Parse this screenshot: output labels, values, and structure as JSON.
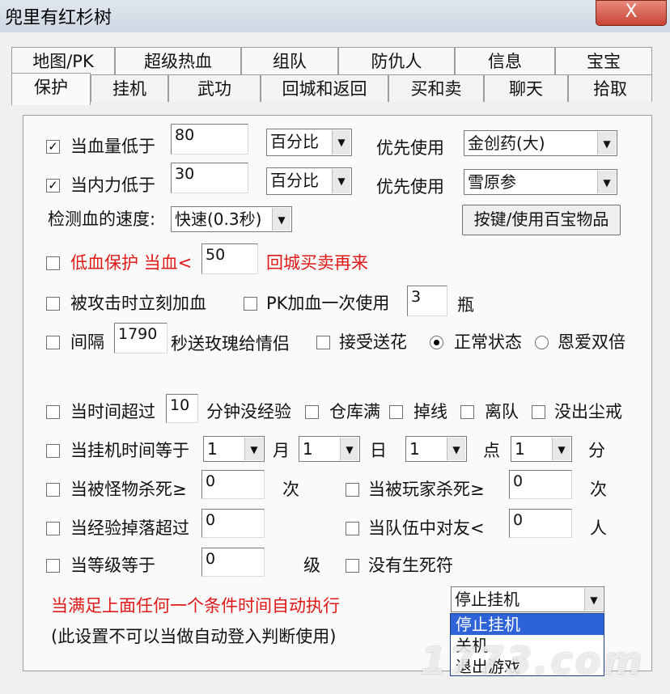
{
  "window": {
    "title": "兜里有红杉树",
    "close_label": "X"
  },
  "tabs_row1": [
    "地图/PK",
    "超级热血",
    "组队",
    "防仇人",
    "信息",
    "宝宝"
  ],
  "tabs_row2": [
    "保护",
    "挂机",
    "武功",
    "回城和返回",
    "买和卖",
    "聊天",
    "拾取"
  ],
  "protect": {
    "hp_label": "当血量低于",
    "hp_value": "80",
    "hp_unit": "百分比",
    "hp_use_label": "优先使用",
    "hp_item": "金创药(大)",
    "mp_label": "当内力低于",
    "mp_value": "30",
    "mp_unit": "百分比",
    "mp_use_label": "优先使用",
    "mp_item": "雪原参",
    "speed_label": "检测血的速度:",
    "speed_value": "快速(0.3秒)",
    "hotkey_button": "按键/使用百宝物品",
    "low_hp_label": "低血保护 当血<",
    "low_hp_value": "50",
    "low_hp_suffix": "回城买卖再来",
    "attacked_label": "被攻击时立刻加血",
    "pk_label": "PK加血一次使用",
    "pk_value": "3",
    "pk_suffix": "瓶",
    "interval_label": "间隔",
    "interval_value": "1790",
    "interval_suffix": "秒送玫瑰给情侣",
    "accept_flower": "接受送花",
    "normal_state": "正常状态",
    "love_double": "恩爱双倍"
  },
  "conditions": {
    "time_label": "当时间超过",
    "time_value": "10",
    "time_suffix": "分钟没经验",
    "warehouse_full": "仓库满",
    "disconnect": "掉线",
    "leave_team": "离队",
    "no_dust_ring": "没出尘戒",
    "afk_time_label": "当挂机时间等于",
    "month_value": "1",
    "month_label": "月",
    "day_value": "1",
    "day_label": "日",
    "hour_value": "1",
    "hour_label": "点",
    "minute_value": "1",
    "minute_label": "分",
    "monster_kill_label": "当被怪物杀死≥",
    "monster_kill_value": "0",
    "monster_kill_unit": "次",
    "player_kill_label": "当被玩家杀死≥",
    "player_kill_value": "0",
    "player_kill_unit": "次",
    "exp_drop_label": "当经验掉落超过",
    "exp_drop_value": "0",
    "team_label": "当队伍中对友<",
    "team_value": "0",
    "team_unit": "人",
    "level_label": "当等级等于",
    "level_value": "0",
    "level_unit": "级",
    "no_talisman": "没有生死符",
    "auto_exec_label": "当满足上面任何一个条件时间自动执行",
    "note": "(此设置不可以当做自动登入判断使用)",
    "action_value": "停止挂机",
    "action_options": [
      "停止挂机",
      "关机",
      "退出游戏"
    ]
  },
  "watermark": "1773.com"
}
